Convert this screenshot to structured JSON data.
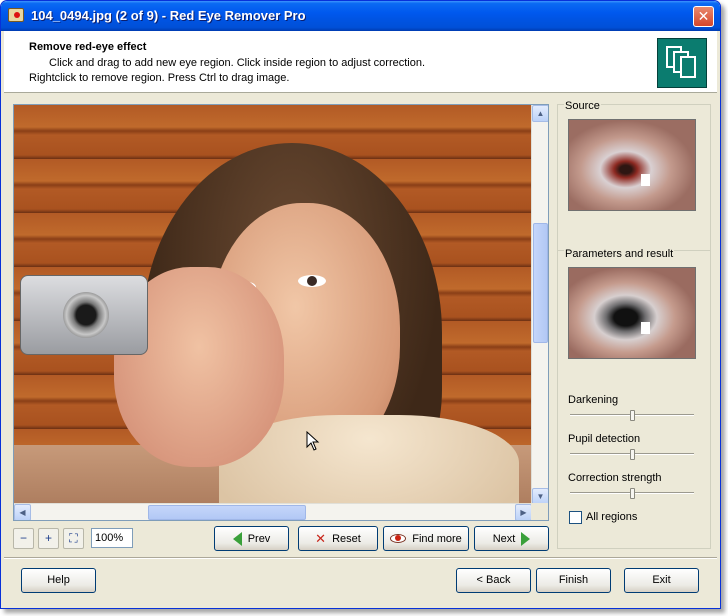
{
  "window": {
    "title": "104_0494.jpg (2 of 9) - Red Eye Remover Pro",
    "close_glyph": "✕"
  },
  "header": {
    "title": "Remove red-eye effect",
    "line1": "Click and drag to add new eye region. Click inside region to adjust correction.",
    "line2": "Rightclick to remove region. Press Ctrl to drag image."
  },
  "icons": {
    "app_logo": "pages-stack-icon",
    "zoom_out": "zoom-out-icon",
    "zoom_in": "zoom-in-icon",
    "fit": "fit-to-window-icon",
    "prev": "green-left-arrow-icon",
    "reset": "reset-x-icon",
    "find_more": "eye-icon",
    "next": "green-right-arrow-icon"
  },
  "scroll_glyphs": {
    "up": "▲",
    "down": "▼",
    "left": "◀",
    "right": "▶"
  },
  "toolbar": {
    "zoom_value": "100%",
    "zoom_out_glyph": "−",
    "zoom_in_glyph": "+",
    "fit_glyph": "⛶",
    "reset_glyph": "✕",
    "prev_label": "Prev",
    "reset_label": "Reset",
    "find_more_label": "Find more",
    "next_label": "Next"
  },
  "panel": {
    "source_label": "Source",
    "params_label": "Parameters and result",
    "darkening_label": "Darkening",
    "pupil_label": "Pupil detection",
    "correction_label": "Correction strength",
    "all_regions_label": "All regions",
    "darkening_value": 0.5,
    "pupil_value": 0.5,
    "correction_value": 0.5,
    "all_regions_checked": false
  },
  "footer": {
    "help": "Help",
    "back": "< Back",
    "finish": "Finish",
    "exit": "Exit"
  },
  "colors": {
    "titlebar": "#0054e3",
    "face": "#3c3c3c",
    "accent_green": "#3aa03a",
    "logo": "#0b7c6f"
  }
}
